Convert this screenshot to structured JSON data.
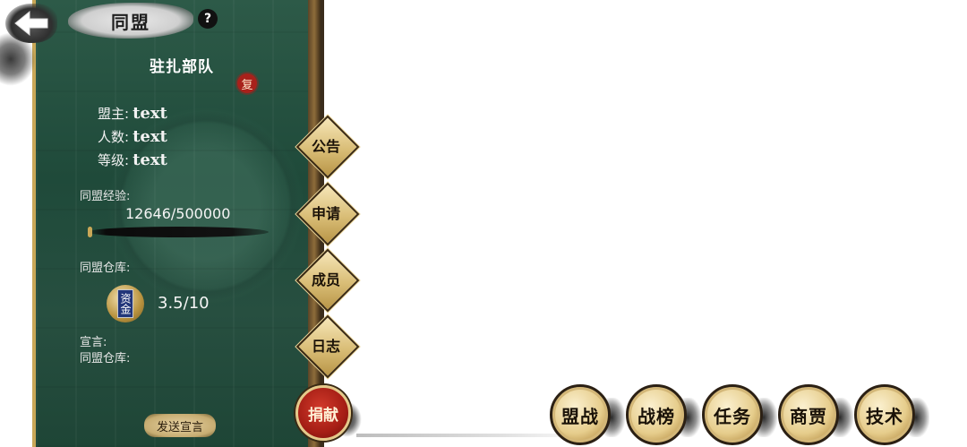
{
  "header": {
    "title": "同盟",
    "help_label": "?",
    "back_icon": "back-arrow-icon"
  },
  "guild": {
    "name": "驻扎部队",
    "revive_label": "复",
    "leader_key": "盟主:",
    "leader_value": "text",
    "members_key": "人数:",
    "members_value": "text",
    "level_key": "等级:",
    "level_value": "text",
    "exp_label": "同盟经验:",
    "exp_value": "12646/500000",
    "exp_progress": 0.025,
    "warehouse_label": "同盟仓库:",
    "fund_icon_text": "资金",
    "fund_value": "3.5/10",
    "declaration_label": "宣言:",
    "declaration_warehouse_label": "同盟仓库:",
    "send_declaration_label": "发送宣言"
  },
  "side_menu": [
    {
      "label": "公告"
    },
    {
      "label": "申请"
    },
    {
      "label": "成员"
    },
    {
      "label": "日志"
    }
  ],
  "donate_label": "捐献",
  "bottom_menu": [
    {
      "label": "盟战"
    },
    {
      "label": "战榜"
    },
    {
      "label": "任务"
    },
    {
      "label": "商贾"
    },
    {
      "label": "技术"
    }
  ],
  "colors": {
    "panel_green": "#274f40",
    "gold": "#c9a757",
    "donate_red": "#a51e15"
  }
}
